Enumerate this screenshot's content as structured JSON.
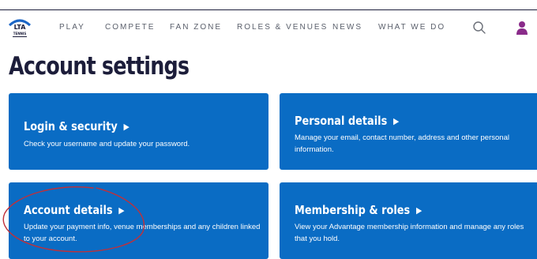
{
  "header": {
    "logo": {
      "text": "LTA",
      "subtext": "TENNIS",
      "accent": "#1c66c6"
    },
    "nav": [
      {
        "label": "PLAY"
      },
      {
        "label": "COMPETE"
      },
      {
        "label": "FAN ZONE"
      },
      {
        "label": "ROLES & VENUES"
      },
      {
        "label": "NEWS"
      },
      {
        "label": "WHAT WE DO"
      }
    ],
    "search_icon": "search-icon",
    "user_icon": "user-icon",
    "user_icon_color": "#8a2b8a"
  },
  "page": {
    "title": "Account settings"
  },
  "cards": [
    {
      "title": "Login & security",
      "description": "Check your username and update your password."
    },
    {
      "title": "Personal details",
      "description": "Manage your email, contact number, address and other personal information."
    },
    {
      "title": "Account details",
      "description": "Update your payment info, venue memberships and any children linked to your account."
    },
    {
      "title": "Membership & roles",
      "description": "View your Advantage membership information and manage any roles that you hold."
    }
  ],
  "colors": {
    "card_bg": "#0a6cc4",
    "title": "#1c1d3a",
    "annotation": "#c0303a"
  }
}
